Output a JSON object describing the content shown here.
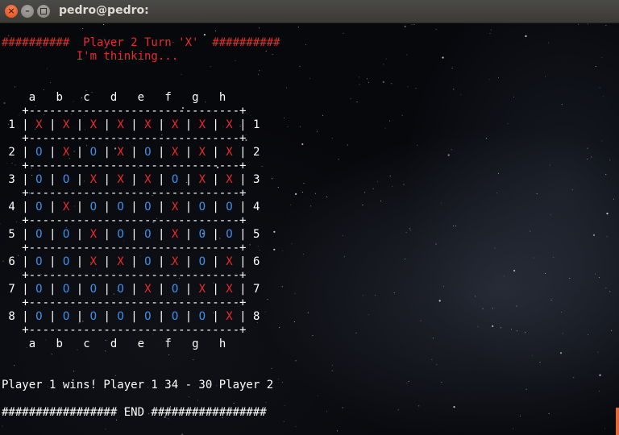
{
  "window": {
    "title": "pedro@pedro:",
    "buttons": {
      "close": "×",
      "minimize": "–"
    }
  },
  "colors": {
    "x_piece": "#ea2b2b",
    "o_piece": "#3b8fe8",
    "text": "#ffffff"
  },
  "terminal": {
    "header_line": "##########  Player 2 Turn 'X'  ##########",
    "thinking_line": "           I'm thinking...",
    "columns": [
      "a",
      "b",
      "c",
      "d",
      "e",
      "f",
      "g",
      "h"
    ],
    "board": [
      [
        "X",
        "X",
        "X",
        "X",
        "X",
        "X",
        "X",
        "X"
      ],
      [
        "O",
        "X",
        "O",
        "X",
        "O",
        "X",
        "X",
        "X"
      ],
      [
        "O",
        "O",
        "X",
        "X",
        "X",
        "O",
        "X",
        "X"
      ],
      [
        "O",
        "X",
        "O",
        "O",
        "O",
        "X",
        "O",
        "O"
      ],
      [
        "O",
        "O",
        "X",
        "O",
        "O",
        "X",
        "O",
        "O"
      ],
      [
        "O",
        "O",
        "X",
        "X",
        "O",
        "X",
        "O",
        "X"
      ],
      [
        "O",
        "O",
        "O",
        "O",
        "X",
        "O",
        "X",
        "X"
      ],
      [
        "O",
        "O",
        "O",
        "O",
        "O",
        "O",
        "O",
        "X"
      ]
    ],
    "result_line": "Player 1 wins! Player 1 34 - 30 Player 2",
    "end_line": "################# END #################"
  }
}
